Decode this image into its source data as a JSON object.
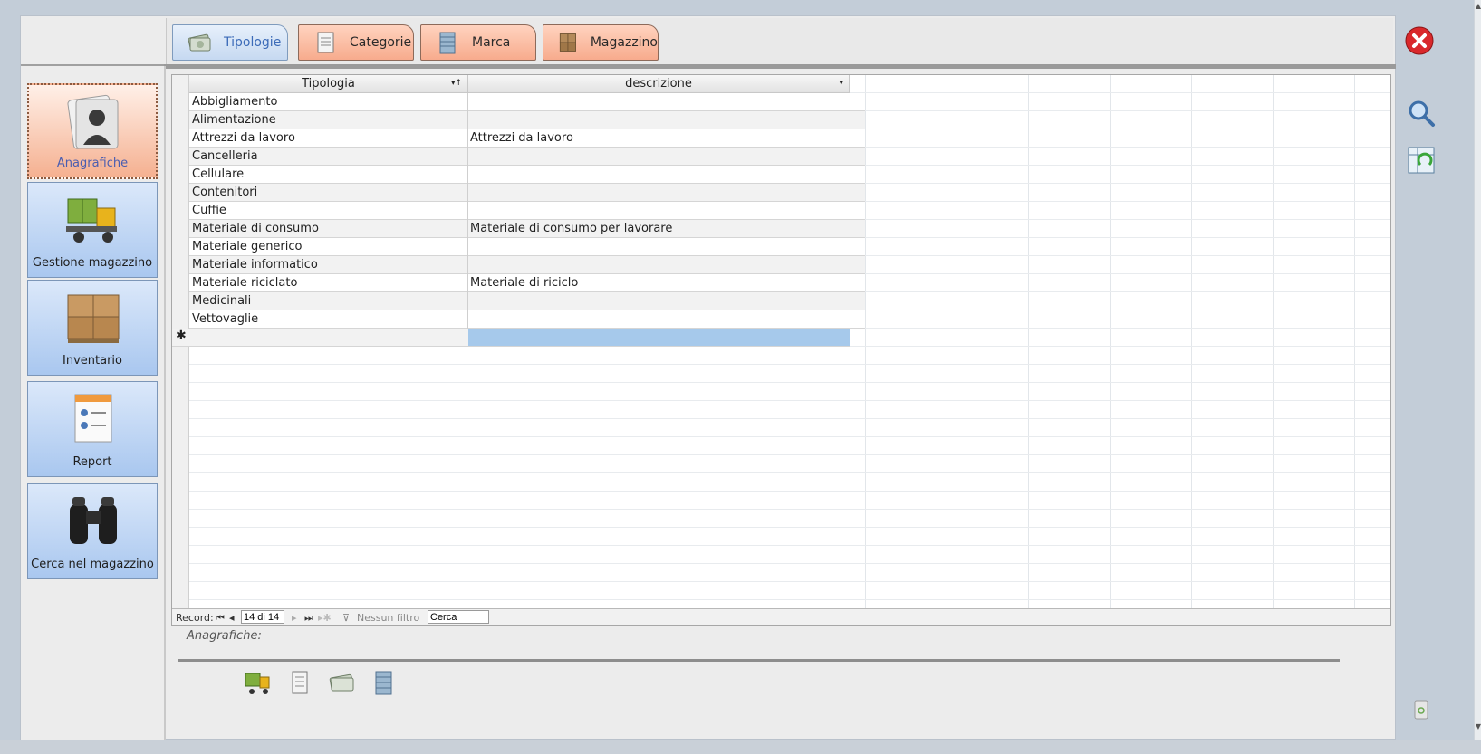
{
  "tabs": [
    {
      "label": "Tipologie",
      "active": true,
      "icon": "money-icon"
    },
    {
      "label": "Categorie",
      "active": false,
      "icon": "document-icon"
    },
    {
      "label": "Marca",
      "active": false,
      "icon": "building-icon"
    },
    {
      "label": "Magazzino",
      "active": false,
      "icon": "boxes-icon"
    }
  ],
  "sidebar": {
    "items": [
      {
        "label": "Anagrafiche",
        "active": true,
        "icon": "user-folder-icon"
      },
      {
        "label": "Gestione magazzino",
        "active": false,
        "icon": "forklift-icon"
      },
      {
        "label": "Inventario",
        "active": false,
        "icon": "boxes-icon"
      },
      {
        "label": "Report",
        "active": false,
        "icon": "report-icon"
      },
      {
        "label": "Cerca nel magazzino",
        "active": false,
        "icon": "binoculars-icon"
      }
    ]
  },
  "table": {
    "columns": [
      "Tipologia",
      "descrizione"
    ],
    "rows": [
      [
        "Abbigliamento",
        ""
      ],
      [
        "Alimentazione",
        ""
      ],
      [
        "Attrezzi da lavoro",
        "Attrezzi da lavoro"
      ],
      [
        "Cancelleria",
        ""
      ],
      [
        "Cellulare",
        ""
      ],
      [
        "Contenitori",
        ""
      ],
      [
        "Cuffie",
        ""
      ],
      [
        "Materiale di consumo",
        "Materiale di consumo per lavorare"
      ],
      [
        "Materiale generico",
        ""
      ],
      [
        "Materiale informatico",
        ""
      ],
      [
        "Materiale riciclato",
        "Materiale di riciclo"
      ],
      [
        "Medicinali",
        ""
      ],
      [
        "Vettovaglie",
        ""
      ]
    ],
    "new_row_marker": "✱"
  },
  "navbar": {
    "record_label": "Record:",
    "count": "14 di 14",
    "filter_label": "Nessun filtro",
    "search_value": "Cerca"
  },
  "caption": "Anagrafiche:",
  "colors": {
    "accent_blue": "#a9c7ef",
    "accent_orange": "#f7ab8d",
    "selection": "#a6c9eb"
  }
}
